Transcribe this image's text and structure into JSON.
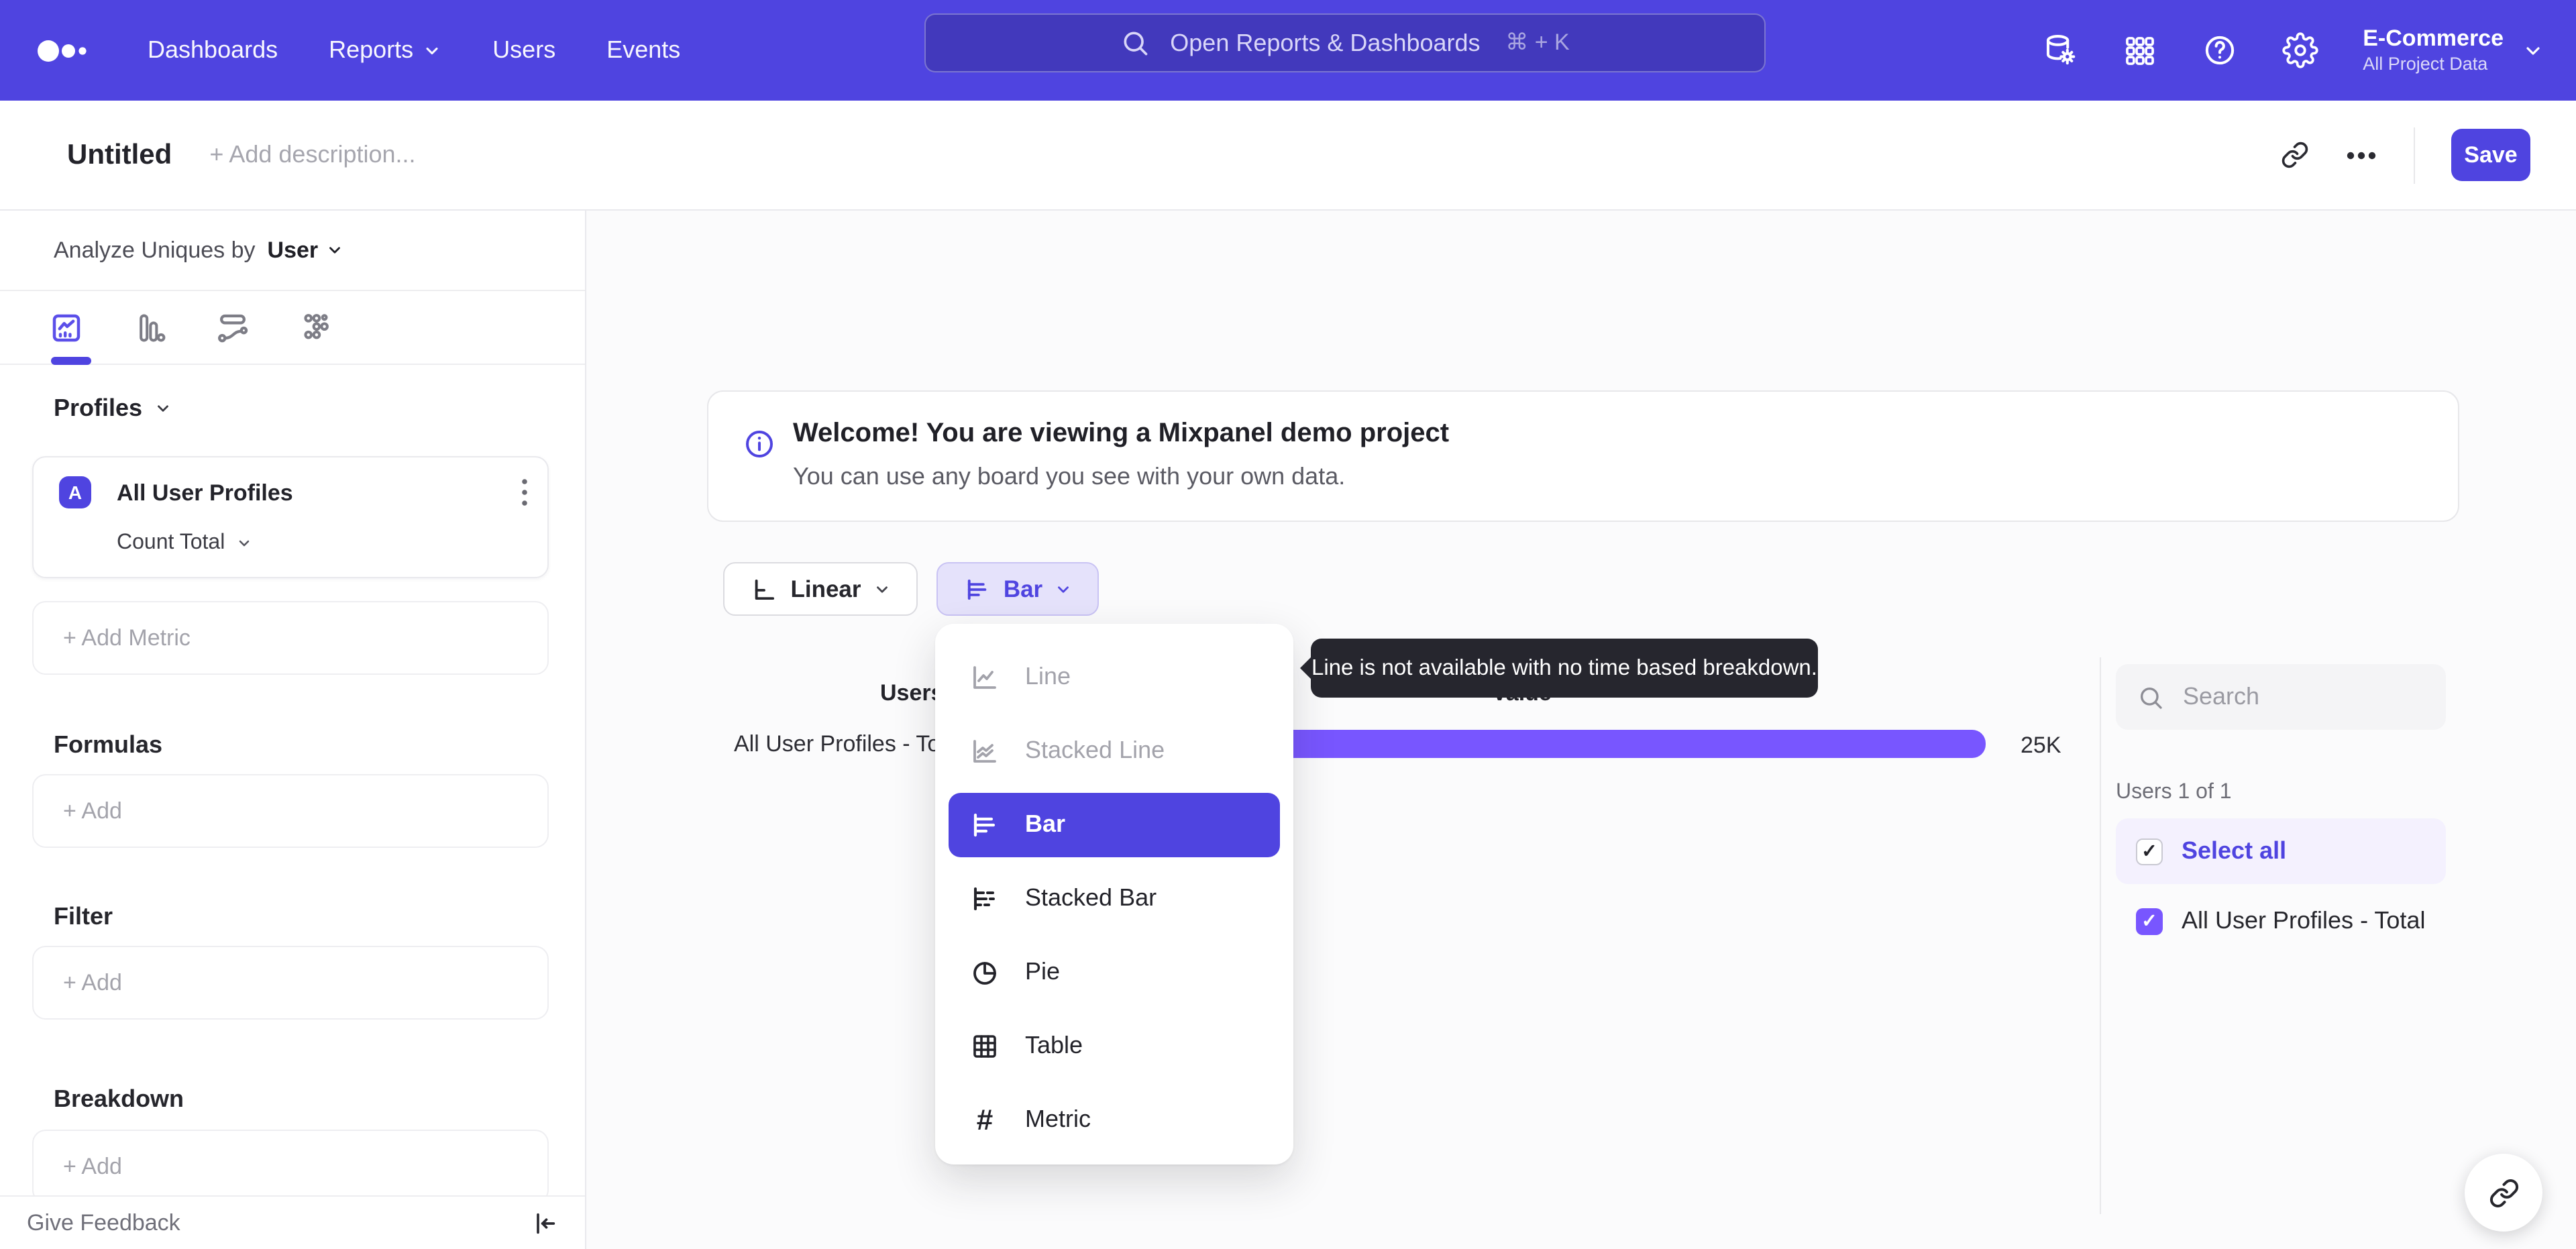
{
  "topnav": {
    "items": [
      "Dashboards",
      "Reports",
      "Users",
      "Events"
    ],
    "search": {
      "placeholder": "Open Reports & Dashboards",
      "shortcut": "⌘ + K"
    },
    "project": {
      "name": "E-Commerce",
      "scope": "All Project Data"
    }
  },
  "titlebar": {
    "title": "Untitled",
    "description_placeholder": "+ Add description...",
    "save_label": "Save"
  },
  "sidebar": {
    "analyze": {
      "prefix": "Analyze Uniques by",
      "value": "User"
    },
    "profiles": {
      "header": "Profiles",
      "metric": {
        "letter": "A",
        "name": "All User Profiles",
        "aggregation": "Count Total"
      },
      "add_metric_label": "+ Add Metric"
    },
    "sections": [
      {
        "header": "Formulas",
        "add_label": "+ Add"
      },
      {
        "header": "Filter",
        "add_label": "+ Add"
      },
      {
        "header": "Breakdown",
        "add_label": "+ Add"
      }
    ],
    "footer": {
      "feedback_label": "Give Feedback"
    }
  },
  "banner": {
    "title": "Welcome! You are viewing a Mixpanel demo project",
    "subtitle": "You can use any board you see with your own data."
  },
  "controls": {
    "scale_label": "Linear",
    "chart_type_label": "Bar"
  },
  "chart_type_menu": {
    "items": [
      {
        "label": "Line",
        "state": "disabled"
      },
      {
        "label": "Stacked Line",
        "state": "disabled"
      },
      {
        "label": "Bar",
        "state": "selected"
      },
      {
        "label": "Stacked Bar",
        "state": "normal"
      },
      {
        "label": "Pie",
        "state": "normal"
      },
      {
        "label": "Table",
        "state": "normal"
      },
      {
        "label": "Metric",
        "state": "normal"
      }
    ]
  },
  "tooltip": {
    "text": "Line is not available with no time based breakdown."
  },
  "chart_data": {
    "type": "bar",
    "orientation": "horizontal",
    "columns": [
      "Users",
      "Value"
    ],
    "rows": [
      {
        "label": "All User Profiles - Total",
        "value": 25000,
        "value_label": "25K"
      }
    ],
    "bar_color": "#7856ff",
    "xlim": [
      0,
      25000
    ],
    "grid": false,
    "legend_position": "right"
  },
  "legend": {
    "search_placeholder": "Search",
    "count_label": "Users 1 of 1",
    "select_all_label": "Select all",
    "items": [
      {
        "label": "All User Profiles - Total",
        "checked": true
      }
    ]
  },
  "colors": {
    "brand": "#4f44e0",
    "bar": "#7856ff",
    "selected_row": "#4f44e0"
  }
}
